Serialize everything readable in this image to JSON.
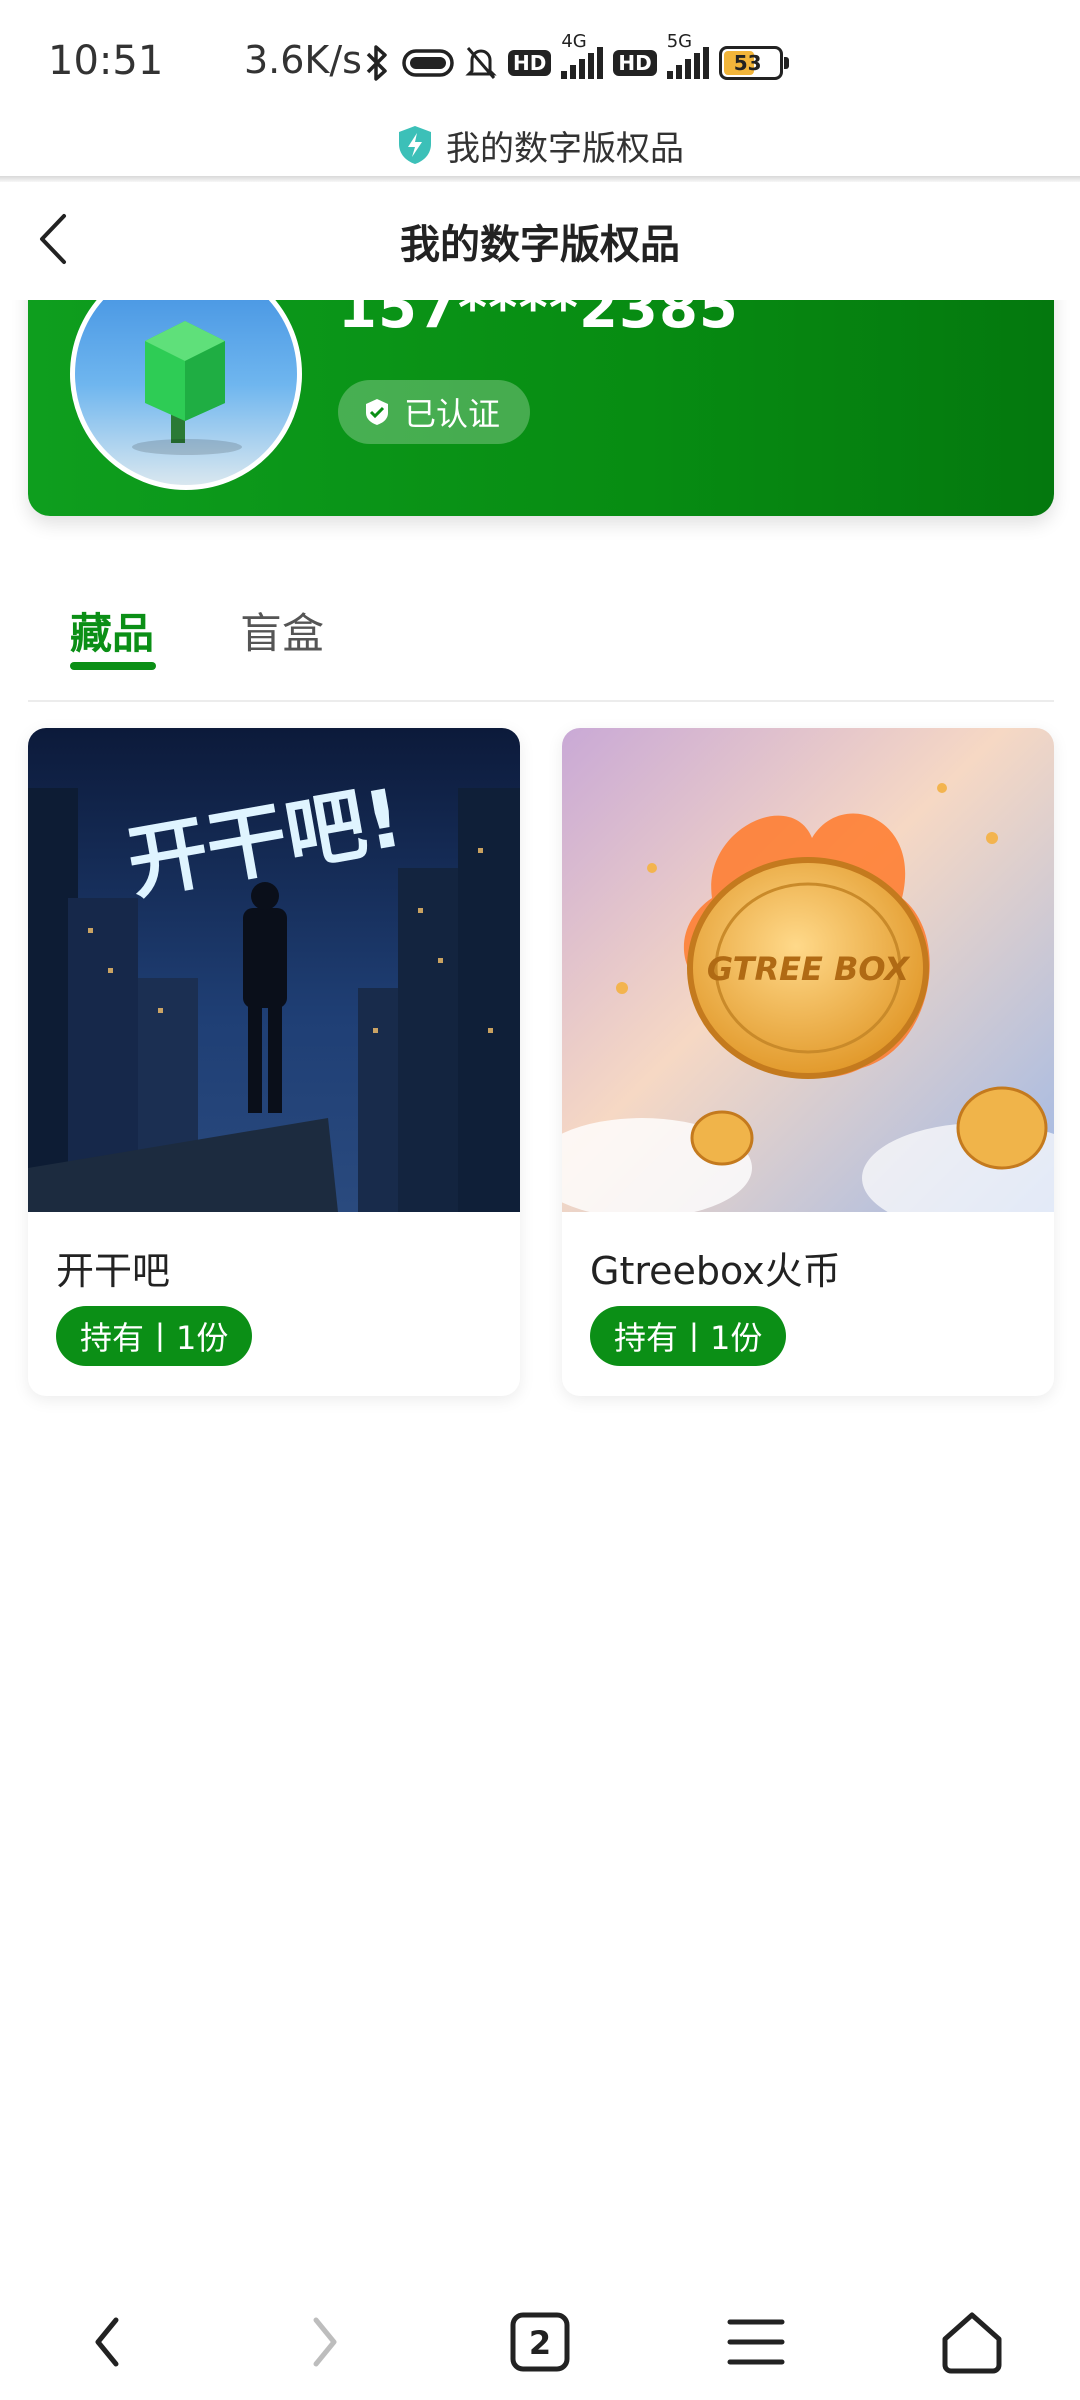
{
  "status_bar": {
    "time": "10:51",
    "network_speed": "3.6K/s",
    "sim1_type": "4G",
    "sim2_type": "5G",
    "hd_label": "HD",
    "battery_level": "53"
  },
  "app_bar": {
    "title": "我的数字版权品"
  },
  "header": {
    "title": "我的数字版权品"
  },
  "profile": {
    "phone": "157****2385",
    "verified_label": "已认证"
  },
  "tabs": [
    {
      "label": "藏品",
      "active": true
    },
    {
      "label": "盲盒",
      "active": false
    }
  ],
  "collection": [
    {
      "title": "开干吧",
      "badge": "持有丨1份",
      "image_text": "开干吧!"
    },
    {
      "title": "Gtreebox火币",
      "badge": "持有丨1份",
      "image_text": "GTREE BOX"
    }
  ],
  "bottom_nav": {
    "tab_count": "2"
  },
  "colors": {
    "brand_green": "#0b8f16",
    "card_green": "#078c12"
  }
}
